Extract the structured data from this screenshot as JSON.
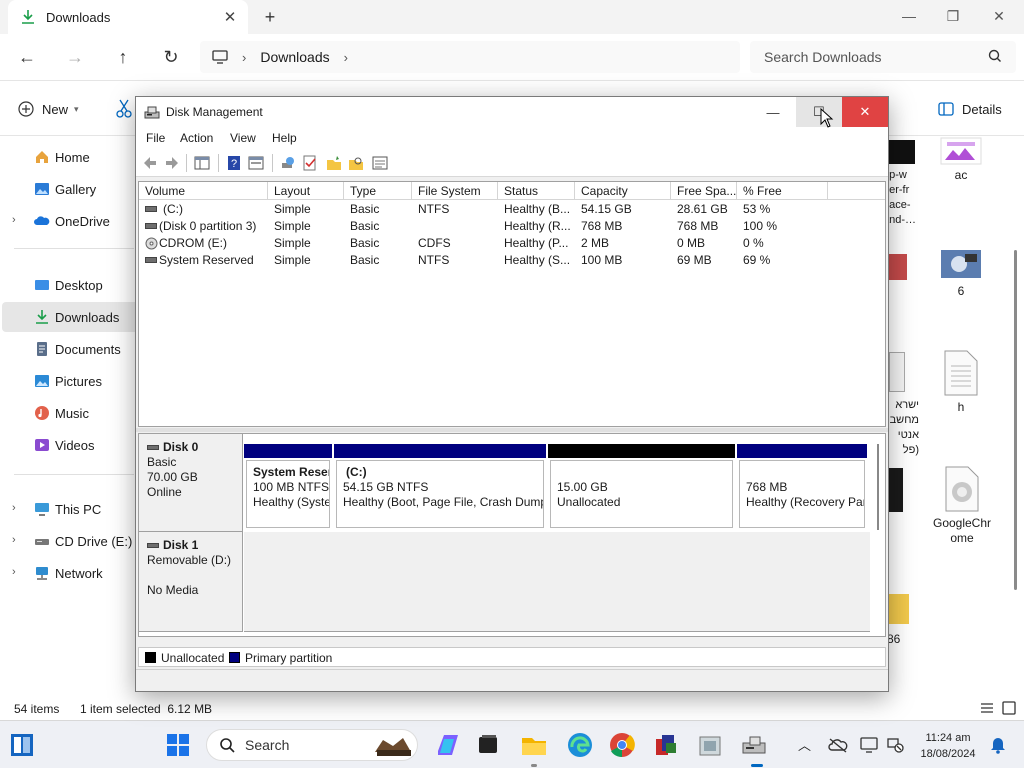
{
  "explorer": {
    "tab_title": "Downloads",
    "address": {
      "crumbs": [
        "Downloads"
      ]
    },
    "search_placeholder": "Search Downloads",
    "commands": {
      "new_label": "New",
      "details_label": "Details"
    },
    "sidebar": [
      {
        "label": "Home",
        "icon": "home-icon"
      },
      {
        "label": "Gallery",
        "icon": "gallery-icon"
      },
      {
        "label": "OneDrive",
        "icon": "onedrive-icon"
      },
      {
        "label": "Desktop",
        "icon": "desktop-icon"
      },
      {
        "label": "Downloads",
        "icon": "downloads-icon",
        "selected": true
      },
      {
        "label": "Documents",
        "icon": "documents-icon"
      },
      {
        "label": "Pictures",
        "icon": "pictures-icon"
      },
      {
        "label": "Music",
        "icon": "music-icon"
      },
      {
        "label": "Videos",
        "icon": "videos-icon"
      },
      {
        "label": "This PC",
        "icon": "this-pc-icon"
      },
      {
        "label": "CD Drive (E:) CD",
        "icon": "cd-drive-icon"
      },
      {
        "label": "Network",
        "icon": "network-icon"
      }
    ],
    "files_partial_col": [
      "op-w",
      "per-fr",
      "pace-",
      "and-…",
      "ישרא",
      "מחשב",
      "אנטי",
      "(פל",
      "86"
    ],
    "files": [
      {
        "label": "ac",
        "icon": "image-file-icon"
      },
      {
        "label": "6",
        "icon": "image-file-icon"
      },
      {
        "label": "h",
        "icon": "text-file-icon"
      },
      {
        "label": "GoogleChrome",
        "label_lines": [
          "GoogleChr",
          "ome"
        ],
        "icon": "chrome-installer-icon"
      }
    ],
    "status": {
      "items_count": "54 items",
      "selection": "1 item selected  6.12 MB"
    }
  },
  "disk_management": {
    "title": "Disk Management",
    "menu": [
      "File",
      "Action",
      "View",
      "Help"
    ],
    "columns": [
      "Volume",
      "Layout",
      "Type",
      "File System",
      "Status",
      "Capacity",
      "Free Spa...",
      "% Free"
    ],
    "volumes": [
      {
        "volume": "(C:)",
        "layout": "Simple",
        "type": "Basic",
        "fs": "NTFS",
        "status": "Healthy (B...",
        "capacity": "54.15 GB",
        "free": "28.61 GB",
        "pct_free": "53 %"
      },
      {
        "volume": "(Disk 0 partition 3)",
        "layout": "Simple",
        "type": "Basic",
        "fs": "",
        "status": "Healthy (R...",
        "capacity": "768 MB",
        "free": "768 MB",
        "pct_free": "100 %"
      },
      {
        "volume": "CDROM (E:)",
        "layout": "Simple",
        "type": "Basic",
        "fs": "CDFS",
        "status": "Healthy (P...",
        "capacity": "2 MB",
        "free": "0 MB",
        "pct_free": "0 %"
      },
      {
        "volume": "System Reserved",
        "layout": "Simple",
        "type": "Basic",
        "fs": "NTFS",
        "status": "Healthy (S...",
        "capacity": "100 MB",
        "free": "69 MB",
        "pct_free": "69 %"
      }
    ],
    "disks": [
      {
        "name": "Disk 0",
        "type": "Basic",
        "size": "70.00 GB",
        "state": "Online",
        "partitions": [
          {
            "title": "System Reser",
            "line1": "100 MB NTFS",
            "line2": "Healthy (Syste",
            "kind": "primary"
          },
          {
            "title": "(C:)",
            "line1": "54.15 GB NTFS",
            "line2": "Healthy (Boot, Page File, Crash Dump",
            "kind": "primary"
          },
          {
            "title": "",
            "line1": "15.00 GB",
            "line2": "Unallocated",
            "kind": "unallocated"
          },
          {
            "title": "",
            "line1": "768 MB",
            "line2": "Healthy (Recovery Par",
            "kind": "primary"
          }
        ]
      },
      {
        "name": "Disk 1",
        "type": "Removable (D:)",
        "size": "",
        "state": "No Media"
      }
    ],
    "legend": [
      {
        "label": "Unallocated",
        "color": "#000000"
      },
      {
        "label": "Primary partition",
        "color": "#00007f"
      }
    ]
  },
  "taskbar": {
    "search_label": "Search",
    "time": "11:24 am",
    "date": "18/08/2024"
  },
  "colors": {
    "primary_partition": "#00007f",
    "unallocated": "#000000",
    "close_button": "#e04343",
    "accent": "#0067c0"
  }
}
